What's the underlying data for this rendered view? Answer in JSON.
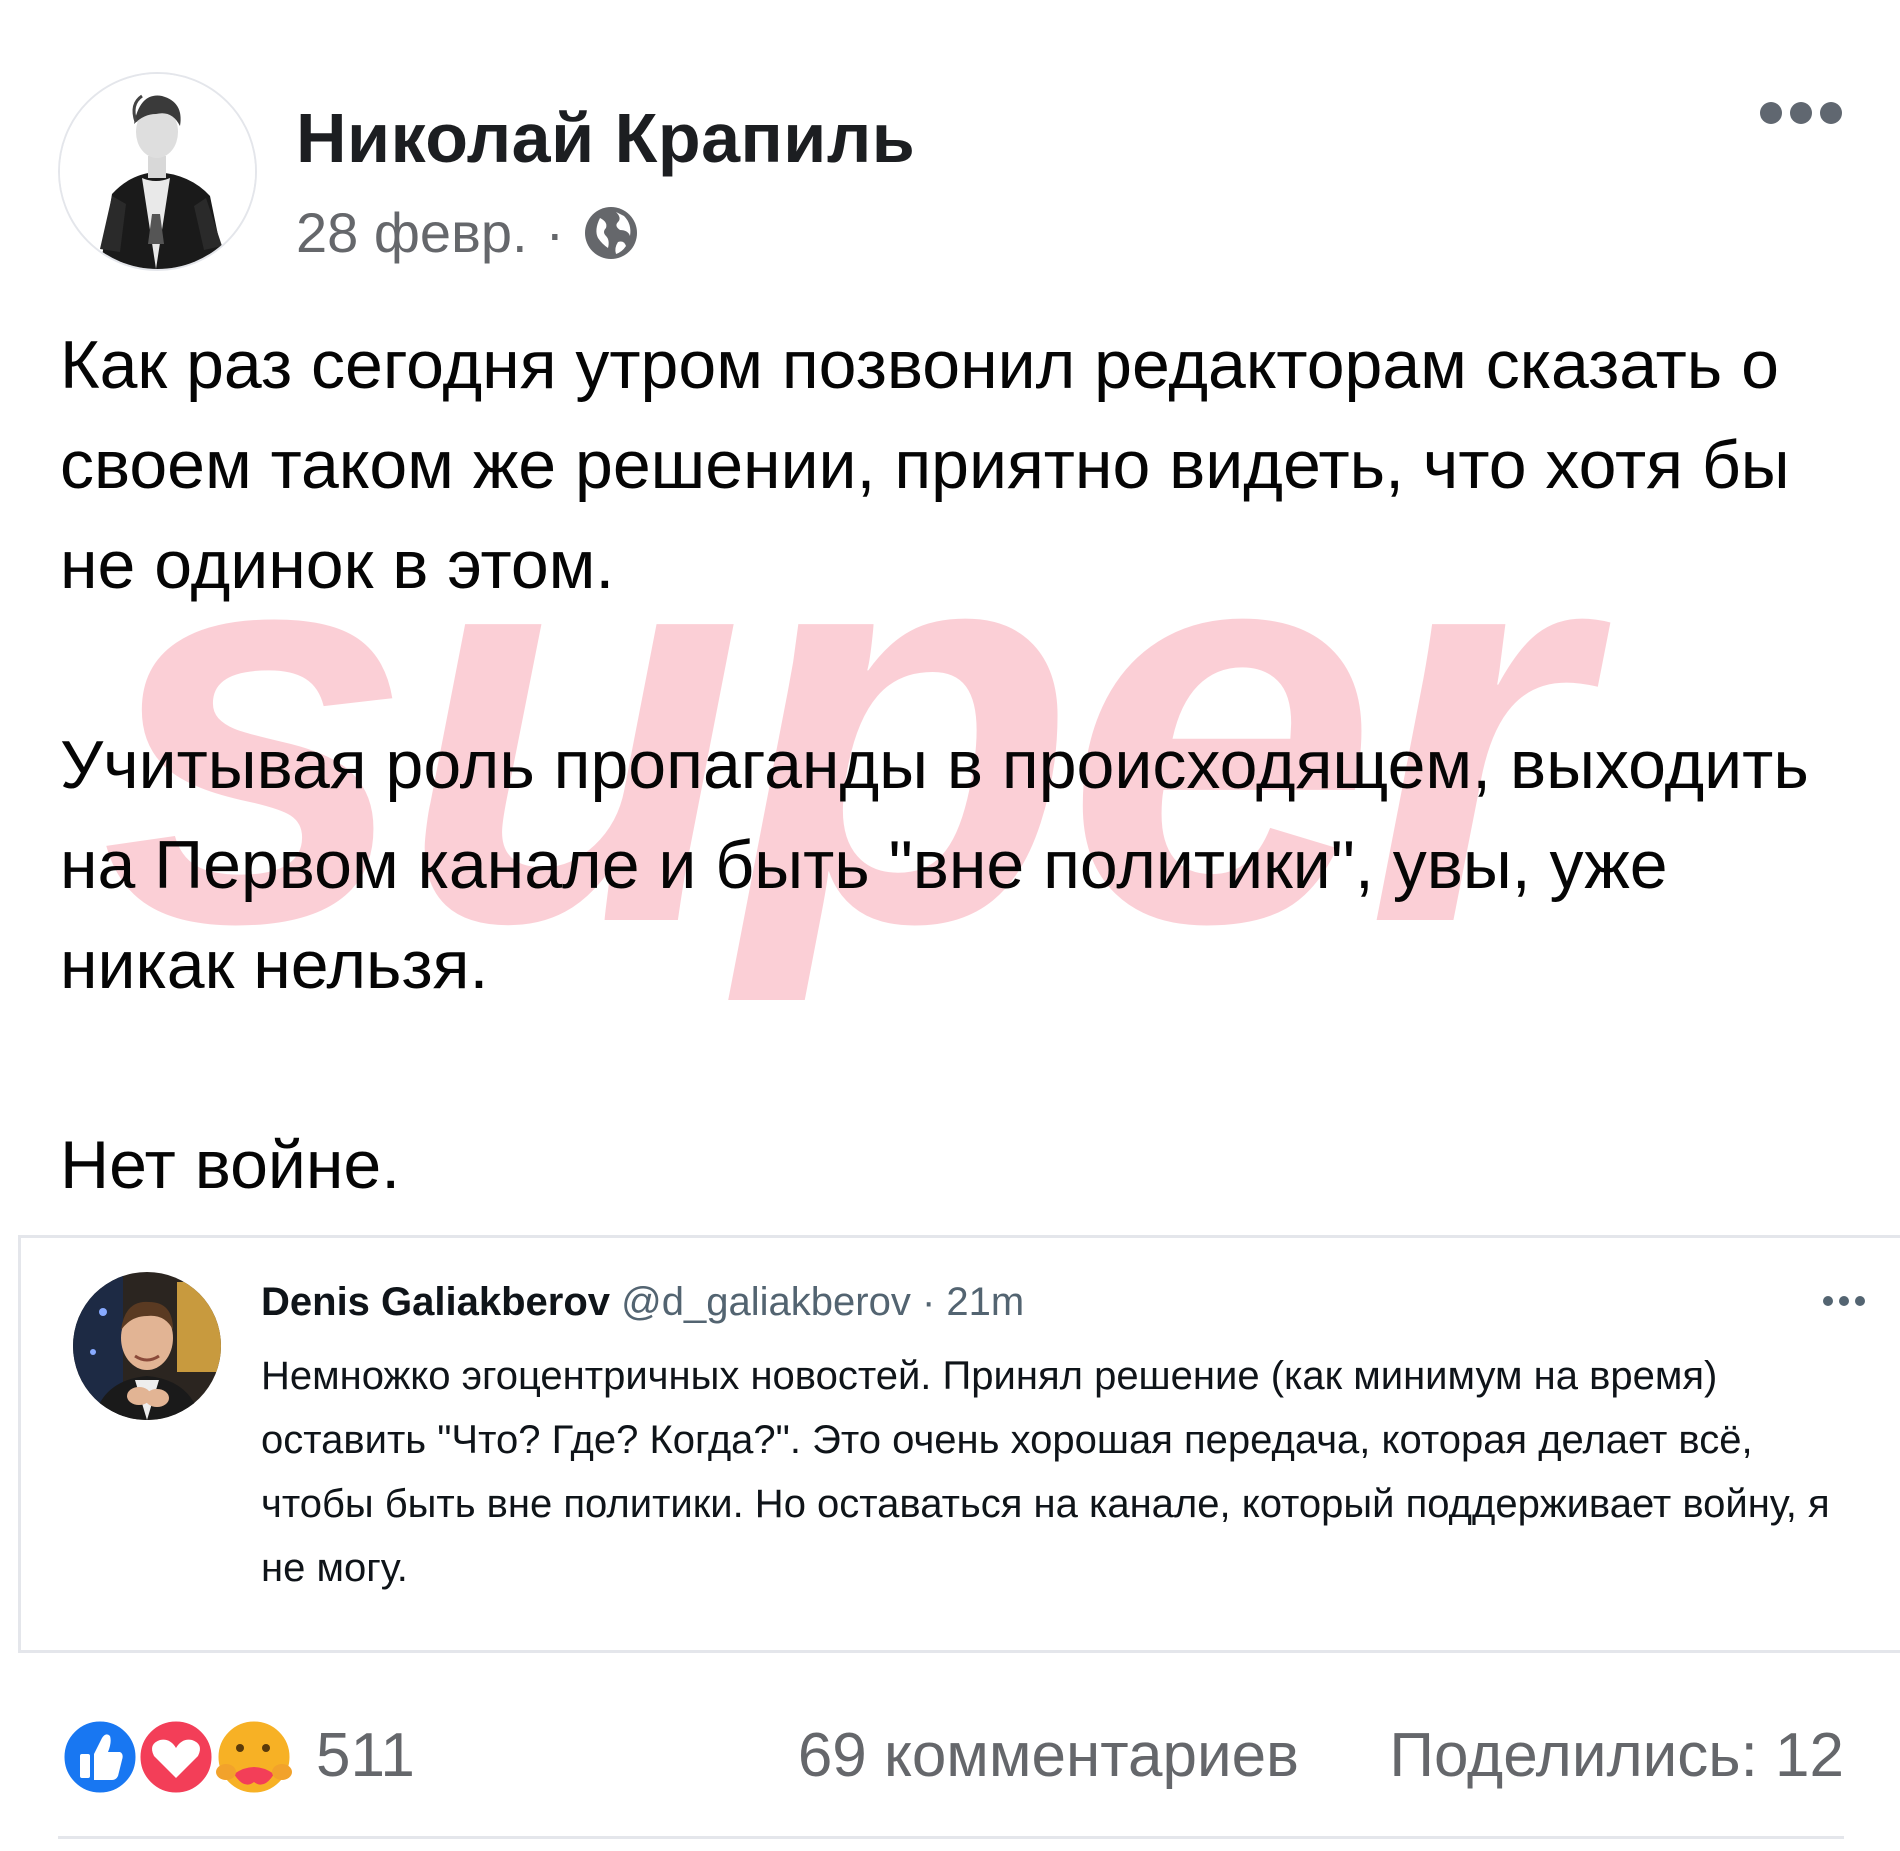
{
  "author": {
    "name": "Николай Крапиль",
    "date": "28 февр.",
    "separator": "·",
    "privacy_icon": "globe-icon"
  },
  "post": {
    "paragraphs": [
      "Как раз сегодня утром позвонил редакторам сказать о своем таком же решении, приятно видеть, что хотя бы не одинок в этом.",
      "Учитывая роль пропаганды в происходящем, выходить на Первом канале и быть \"вне политики\", увы, уже никак нельзя.",
      "Нет войне."
    ]
  },
  "watermark": {
    "text": "super",
    "color": "#f7a8b4"
  },
  "tweet": {
    "name": "Denis Galiakberov",
    "handle": "@d_galiakberov",
    "separator": "·",
    "time": "21m",
    "text": "Немножко эгоцентричных новостей. Принял решение (как минимум на время) оставить \"Что? Где? Когда?\". Это очень хорошая передача, которая делает всё, чтобы быть вне политики. Но оставаться на канале, который поддерживает войну, я не могу."
  },
  "footer": {
    "reaction_icons": [
      "like-icon",
      "love-icon",
      "care-icon"
    ],
    "reaction_count": "511",
    "comments": "69 комментариев",
    "shares": "Поделились: 12"
  },
  "colors": {
    "like_blue": "#1877f2",
    "love_red": "#f33e58",
    "care_yellow": "#f7b125",
    "secondary_text": "#65676b"
  }
}
